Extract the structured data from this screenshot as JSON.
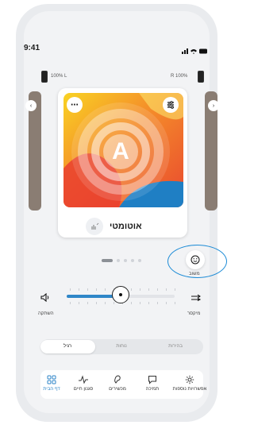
{
  "status_bar": {
    "time": "9:41",
    "signal_icons": "մմմ ◔ ▬"
  },
  "battery": {
    "left_label": "100% L",
    "right_label": "R 100%"
  },
  "program": {
    "title": "אוטומטי",
    "letter": "A"
  },
  "page_dots": 5,
  "mood_button": {
    "label": "משוב"
  },
  "volume": {
    "mute_label": "השתקה",
    "mixer_label": "מיקסר",
    "level_percent": 50
  },
  "segments": [
    {
      "label": "רגיל",
      "active": true
    },
    {
      "label": "נוחות",
      "active": false
    },
    {
      "label": "בהירות",
      "active": false
    }
  ],
  "nav": [
    {
      "label": "דף הבית",
      "icon": "home-grid-icon",
      "active": true
    },
    {
      "label": "סגנון חיים",
      "icon": "pulse-icon",
      "active": false
    },
    {
      "label": "מכשירים",
      "icon": "hearing-aid-icon",
      "active": false
    },
    {
      "label": "תמיכה",
      "icon": "chat-icon",
      "active": false
    },
    {
      "label": "אפשרויות נוספות",
      "icon": "gear-icon",
      "active": false
    }
  ],
  "colors": {
    "accent": "#2f86c8",
    "highlight_ring": "#1c8bd6"
  }
}
